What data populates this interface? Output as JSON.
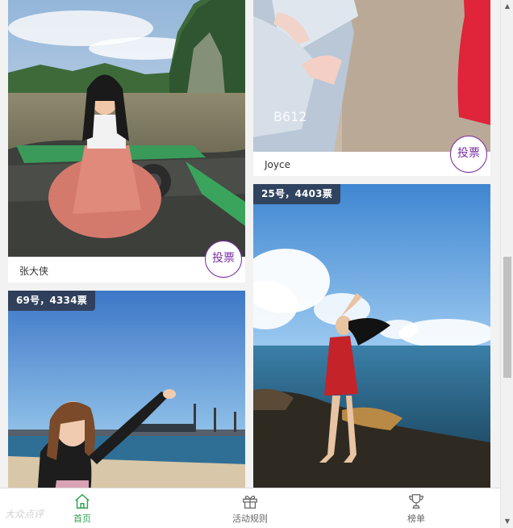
{
  "cards": [
    {
      "name": "张大侠",
      "vote_label": "投票"
    },
    {
      "name": "Joyce",
      "vote_label": "投票"
    },
    {
      "badge": "25号，4403票"
    },
    {
      "badge": "69号，4334票"
    }
  ],
  "tabbar": {
    "items": [
      {
        "label": "首页",
        "icon": "home-icon",
        "active": true
      },
      {
        "label": "活动规则",
        "icon": "gift-icon",
        "active": false
      },
      {
        "label": "榜单",
        "icon": "trophy-icon",
        "active": false
      }
    ]
  },
  "watermark": "大众点评",
  "colors": {
    "accent": "#7b2fa3",
    "active_tab": "#2ea44f",
    "badge_bg": "#282832"
  }
}
